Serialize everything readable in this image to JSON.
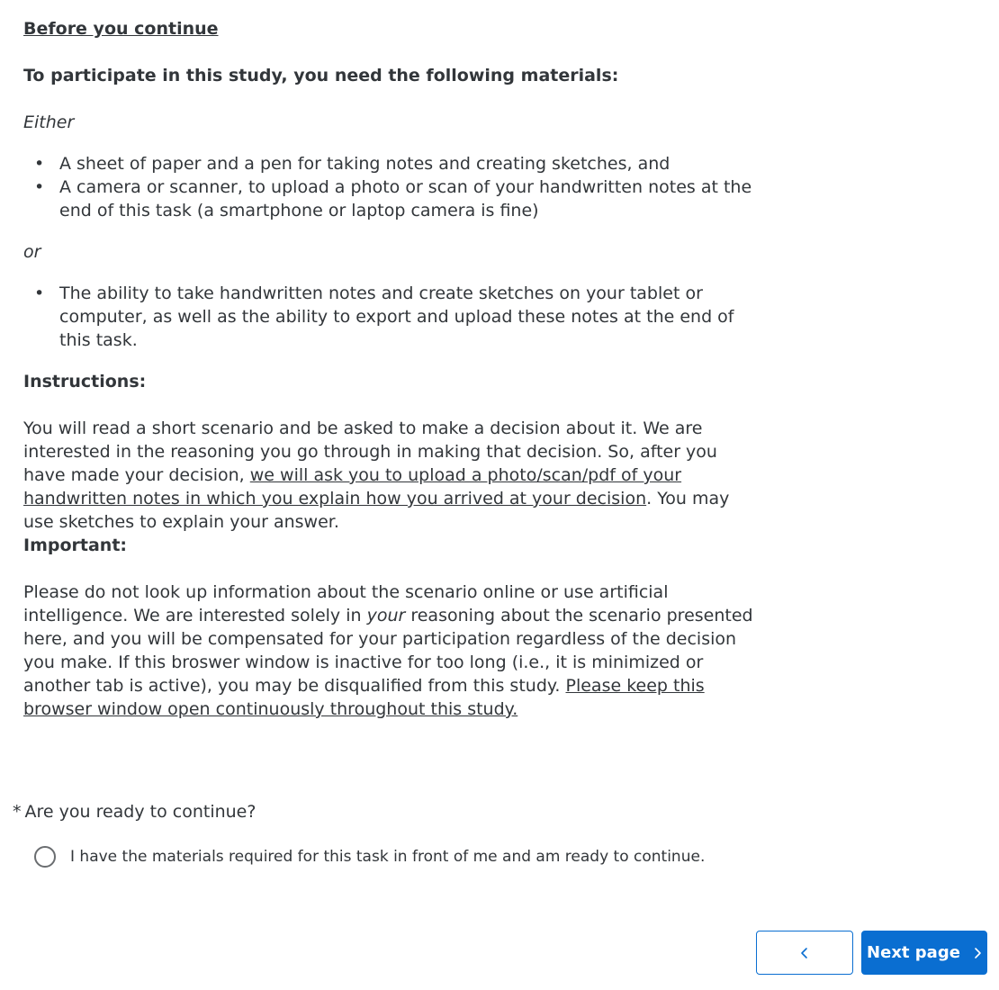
{
  "intro": {
    "heading": "Before you continue",
    "materials_heading": "To participate in this study, you need the following materials:",
    "either": "Either",
    "either_items": [
      "A sheet of paper and a pen for taking notes and creating sketches, and",
      "A camera or scanner, to upload a photo or scan of your handwritten notes at the end of this task (a smartphone or laptop camera is fine)"
    ],
    "or": "or",
    "or_items": [
      "The ability to take handwritten notes and create sketches on your tablet or computer, as well as the ability to export and upload these notes at the end of this task."
    ]
  },
  "instructions": {
    "heading": "Instructions:",
    "text_part1": "You will read a short scenario and be asked to make a decision about it. We are interested in the reasoning you go through in making that decision. So, after you have made your decision, ",
    "text_underlined": "we will ask you to upload a photo/scan/pdf of your handwritten notes in which you explain how you arrived at your decision",
    "text_part2": ". You may use sketches to explain your answer."
  },
  "important": {
    "heading": "Important:",
    "text_part1": "Please do not look up information about the scenario online or use artificial intelligence. We are interested solely in ",
    "text_italic": "your",
    "text_part2": " reasoning about the scenario presented here, and you will be compensated for your participation regardless of the decision you make. If this broswer window is inactive for too long (i.e., it is minimized or another tab is active), you may be disqualified from this study. ",
    "text_underlined": "Please keep this browser window open continuously throughout this study."
  },
  "question": {
    "required_marker": "*",
    "label": "Are you ready to continue?",
    "option_label": "I have the materials required for this task in front of me and am ready to continue.",
    "selected": false
  },
  "navigation": {
    "next_label": "Next page",
    "back_icon": "chevron-left-icon",
    "next_icon": "chevron-right-icon",
    "accent_color": "#0a6ed1"
  }
}
